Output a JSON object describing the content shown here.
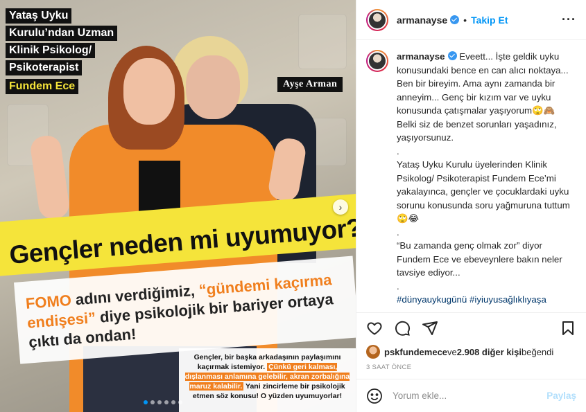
{
  "media": {
    "caption_lines": [
      "Yataş Uyku",
      "Kurulu’ndan Uzman",
      "Klinik Psikolog/",
      "Psikoterapist"
    ],
    "caption_name": "Fundem Ece",
    "name_tag": "Ayşe Arman",
    "headline": "Gençler neden mi uyumuyor?",
    "sub": {
      "part1": "FOMO",
      "part2": " adını verdiğimiz, ",
      "part3": "“gündemi kaçırma endişesi”",
      "part4": " diye psikolojik bir bariyer ortaya çıktı da ondan!"
    },
    "quote": {
      "text1": "Gençler, bir başka arkadaşının paylaşımını kaçırmak istemiyor. ",
      "hl": "Çünkü geri kalması, dışlanması anlamına gelebilir, akran zorbalığına maruz kalabilir.",
      "text2": " Yani zincirleme bir psikolojik etmen söz konusu! O yüzden uyumuyorlar!"
    },
    "next_arrow": "›",
    "carousel_dots": 6,
    "active_dot": 0
  },
  "header": {
    "username": "armanayse",
    "separator": "•",
    "follow_label": "Takip Et",
    "more": "···"
  },
  "caption": {
    "username": "armanayse",
    "text": "Eveett... İşte geldik uyku konusundaki bence en can alıcı noktaya... Ben bir bireyim. Ama aynı zamanda bir anneyim... Genç bir kızım var ve uyku konusunda çatışmalar yaşıyorum🙄🙈 Belki siz de benzet sorunları yaşadınız, yaşıyorsunuz.\n.\nYataş Uyku Kurulu üyelerinden Klinik Psikolog/ Psikoterapist Fundem Ece’mi yakalayınca, gençler ve çocuklardaki uyku sorunu konusunda soru yağmuruna tuttum🙄😂\n.\n“Bu zamanda genç olmak zor” diyor Fundem Ece ve ebeveynlere bakın neler tavsiye ediyor...\n.",
    "hashtags": "#dünyauykugünü #iyiuyusağlıklıyaşa"
  },
  "likes": {
    "first_user": "pskfundemece",
    "connector": " ve ",
    "count_text": "2.908 diğer kişi",
    "suffix": " beğendi"
  },
  "timestamp": "3 SAAT ÖNCE",
  "comment_box": {
    "placeholder": "Yorum ekle...",
    "post_label": "Paylaş"
  }
}
